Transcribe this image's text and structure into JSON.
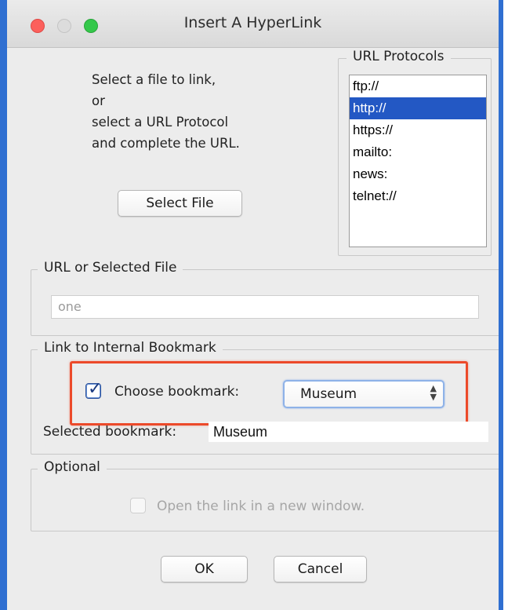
{
  "window": {
    "title": "Insert A HyperLink"
  },
  "instructions": {
    "lines": [
      "Select a file to link,",
      "or",
      "select a URL Protocol",
      "and complete the URL."
    ]
  },
  "buttons": {
    "select_file": "Select File",
    "ok": "OK",
    "cancel": "Cancel"
  },
  "url_protocols": {
    "legend": "URL Protocols",
    "items": [
      "ftp://",
      "http://",
      "https://",
      "mailto:",
      "news:",
      "telnet://"
    ],
    "selected": "http://"
  },
  "url_file": {
    "legend": "URL or Selected File",
    "value": "one"
  },
  "bookmark": {
    "legend": "Link to Internal Bookmark",
    "checkbox_label": "Choose bookmark:",
    "checked": true,
    "select_value": "Museum",
    "selected_label": "Selected bookmark:",
    "selected_value": "Museum"
  },
  "optional": {
    "legend": "Optional",
    "new_window_label": "Open the link in a new window.",
    "checked": false
  },
  "colors": {
    "highlight": "#ec4a2a",
    "selection": "#2358c4",
    "frame": "#2f6fd1"
  }
}
